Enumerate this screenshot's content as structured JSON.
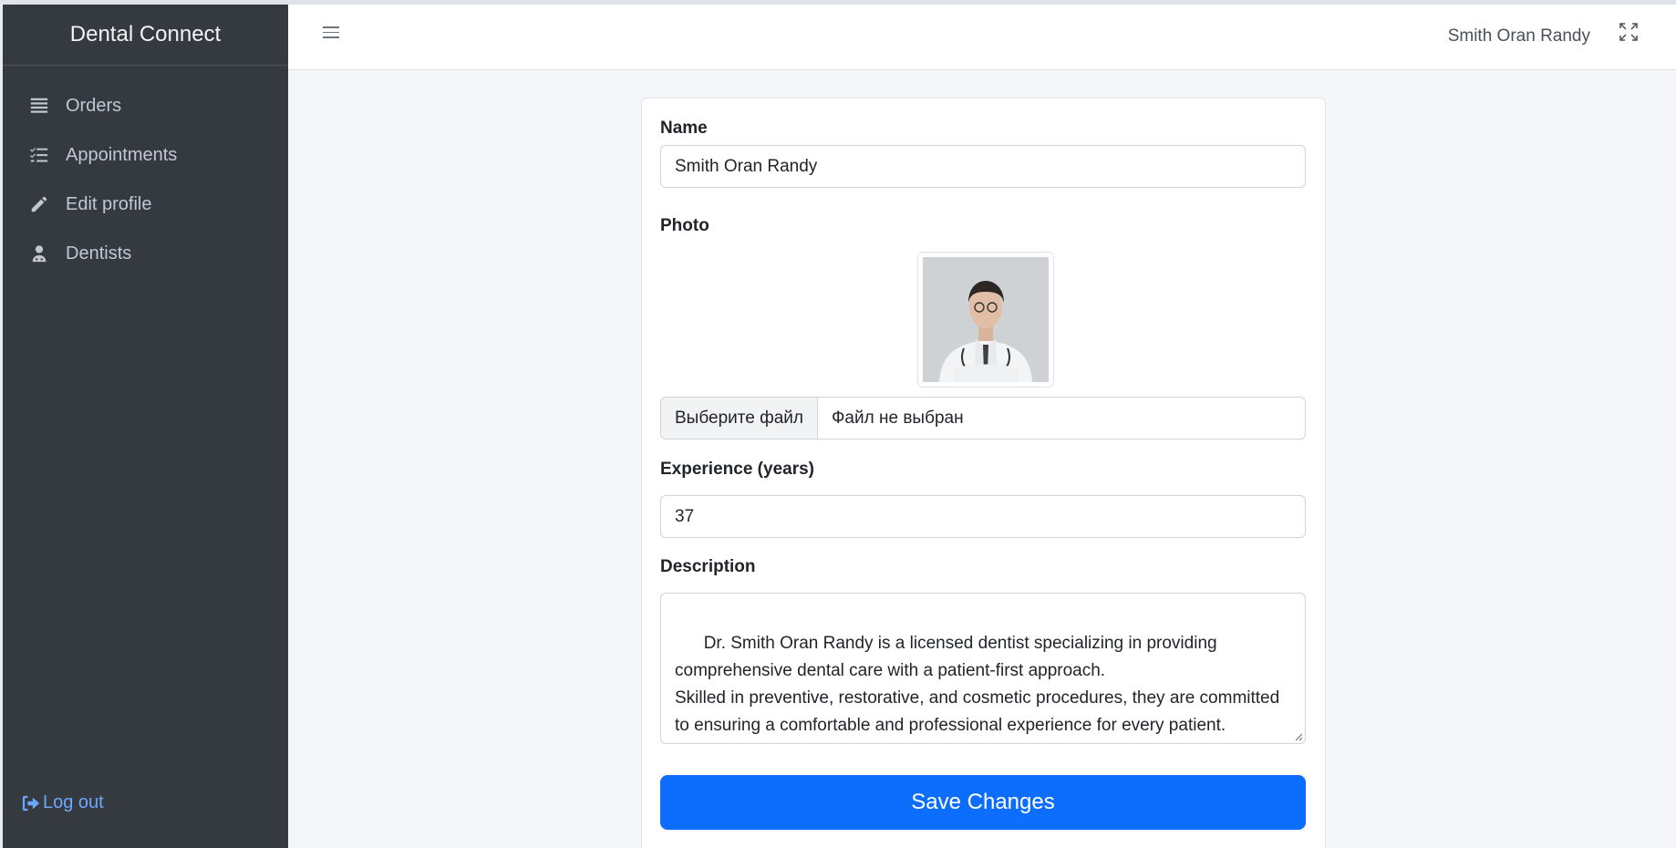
{
  "app": {
    "brand": "Dental Connect"
  },
  "sidebar": {
    "items": [
      {
        "label": "Orders",
        "icon": "list-icon"
      },
      {
        "label": "Appointments",
        "icon": "checklist-icon"
      },
      {
        "label": "Edit profile",
        "icon": "pencil-icon"
      },
      {
        "label": "Dentists",
        "icon": "user-doctor-icon"
      }
    ],
    "logout_label": "Log out"
  },
  "header": {
    "user_name": "Smith Oran Randy"
  },
  "form": {
    "name_label": "Name",
    "name_value": "Smith Oran Randy",
    "photo_label": "Photo",
    "file_button": "Выберите файл",
    "file_status": "Файл не выбран",
    "experience_label": "Experience (years)",
    "experience_value": "37",
    "description_label": "Description",
    "description_value": "Dr. Smith Oran Randy is a licensed dentist specializing in providing\ncomprehensive dental care with a patient-first approach.\nSkilled in preventive, restorative, and cosmetic procedures, they are committed\nto ensuring a comfortable and professional experience for every patient.",
    "save_label": "Save Changes"
  },
  "colors": {
    "sidebar_bg": "#343a40",
    "primary": "#0d6efd",
    "link": "#6ea8fe"
  }
}
